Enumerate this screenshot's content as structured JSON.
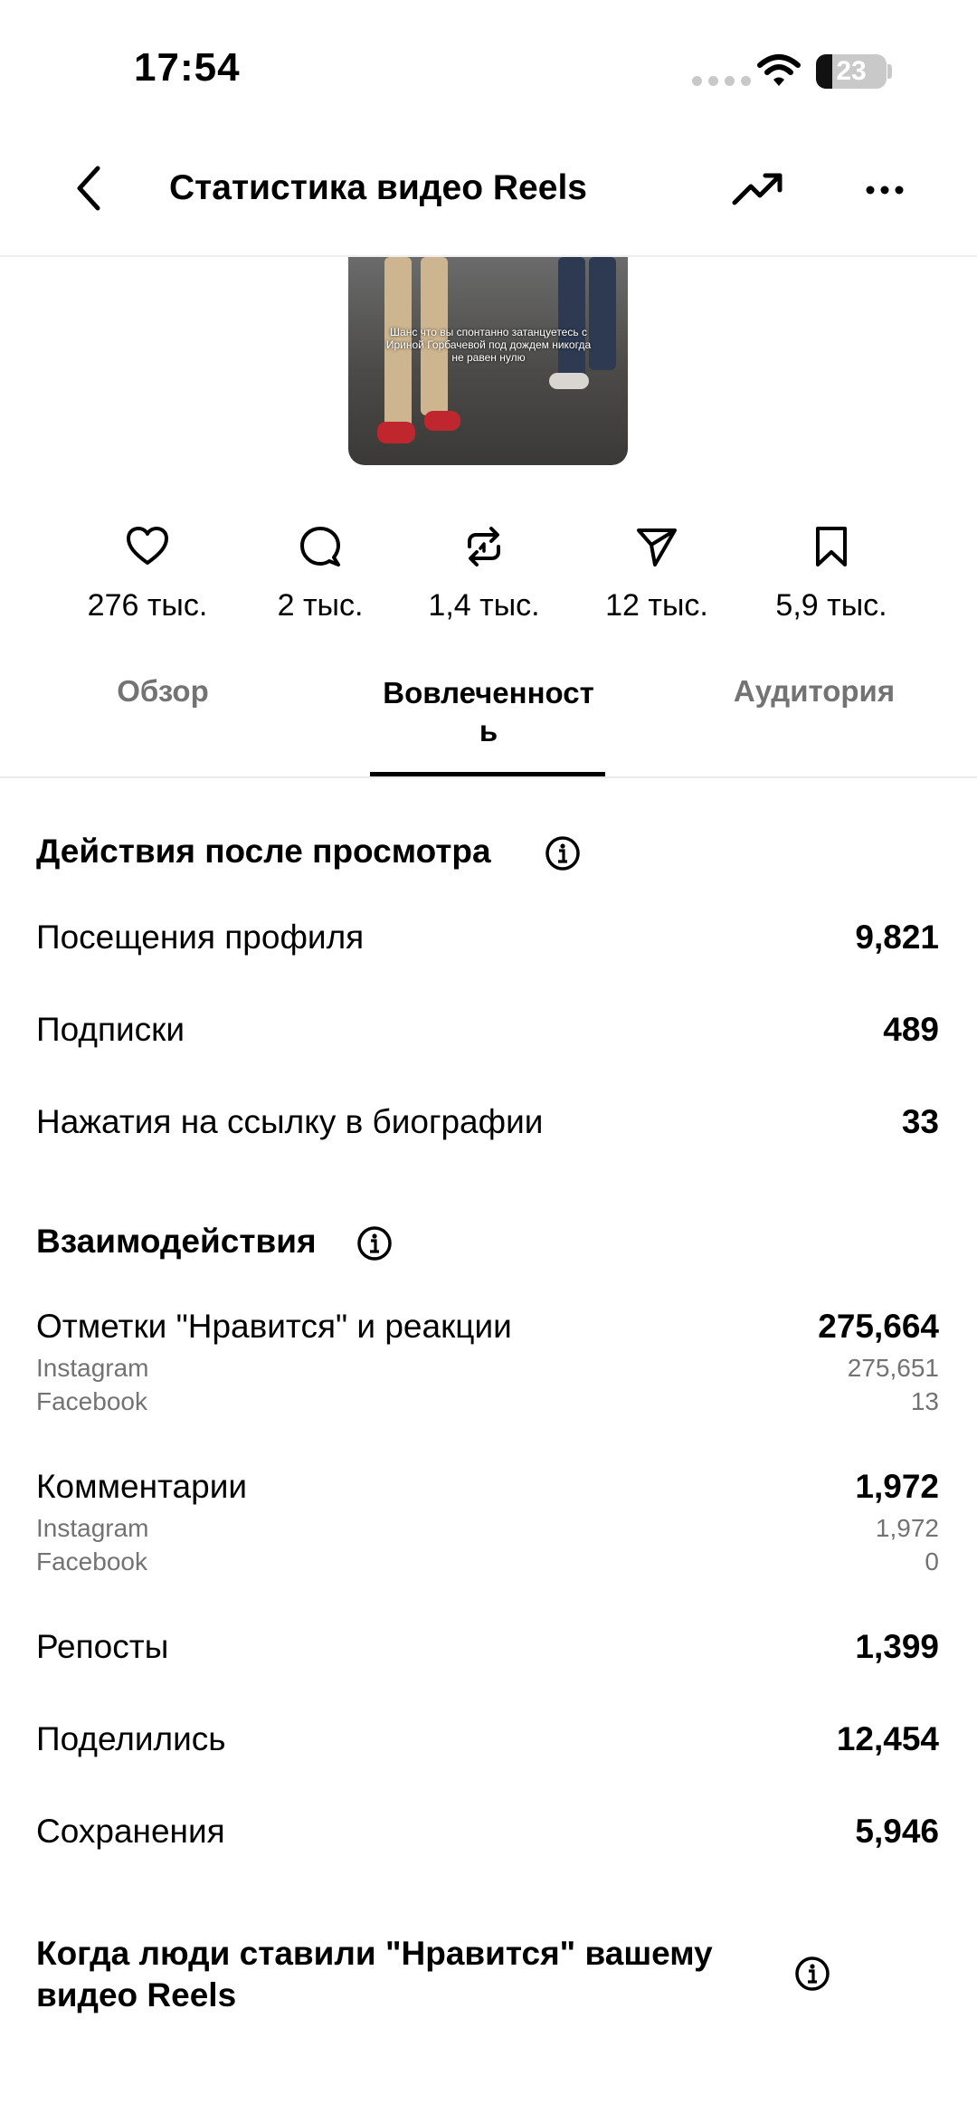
{
  "status_bar": {
    "time": "17:54",
    "battery": "23",
    "battery_level": 0.23
  },
  "header": {
    "title": "Статистика видео Reels"
  },
  "thumbnail": {
    "caption": "Шанс что вы спонтанно затанцуетесь с Ириной Горбачевой под дождем никогда не равен нулю"
  },
  "stats": [
    {
      "icon": "heart-icon",
      "value": "276 тыс."
    },
    {
      "icon": "comment-icon",
      "value": "2 тыс."
    },
    {
      "icon": "repost-icon",
      "value": "1,4 тыс."
    },
    {
      "icon": "share-icon",
      "value": "12 тыс."
    },
    {
      "icon": "bookmark-icon",
      "value": "5,9 тыс."
    }
  ],
  "tabs": {
    "overview": "Обзор",
    "engagement_line1": "Вовлеченност",
    "engagement_line2": "ь",
    "audience": "Аудитория",
    "active": "engagement"
  },
  "actions": {
    "title": "Действия после просмотра",
    "rows": [
      {
        "label": "Посещения профиля",
        "value": "9,821"
      },
      {
        "label": "Подписки",
        "value": "489"
      },
      {
        "label": "Нажатия на ссылку в биографии",
        "value": "33"
      }
    ]
  },
  "interactions": {
    "title": "Взаимодействия",
    "likes": {
      "label": "Отметки \"Нравится\" и реакции",
      "value": "275,664",
      "instagram_label": "Instagram",
      "instagram_value": "275,651",
      "facebook_label": "Facebook",
      "facebook_value": "13"
    },
    "comments": {
      "label": "Комментарии",
      "value": "1,972",
      "instagram_label": "Instagram",
      "instagram_value": "1,972",
      "facebook_label": "Facebook",
      "facebook_value": "0"
    },
    "reposts": {
      "label": "Репосты",
      "value": "1,399"
    },
    "shares": {
      "label": "Поделились",
      "value": "12,454"
    },
    "saves": {
      "label": "Сохранения",
      "value": "5,946"
    }
  },
  "when_liked": {
    "title": "Когда люди ставили \"Нравится\" вашему видео Reels"
  }
}
